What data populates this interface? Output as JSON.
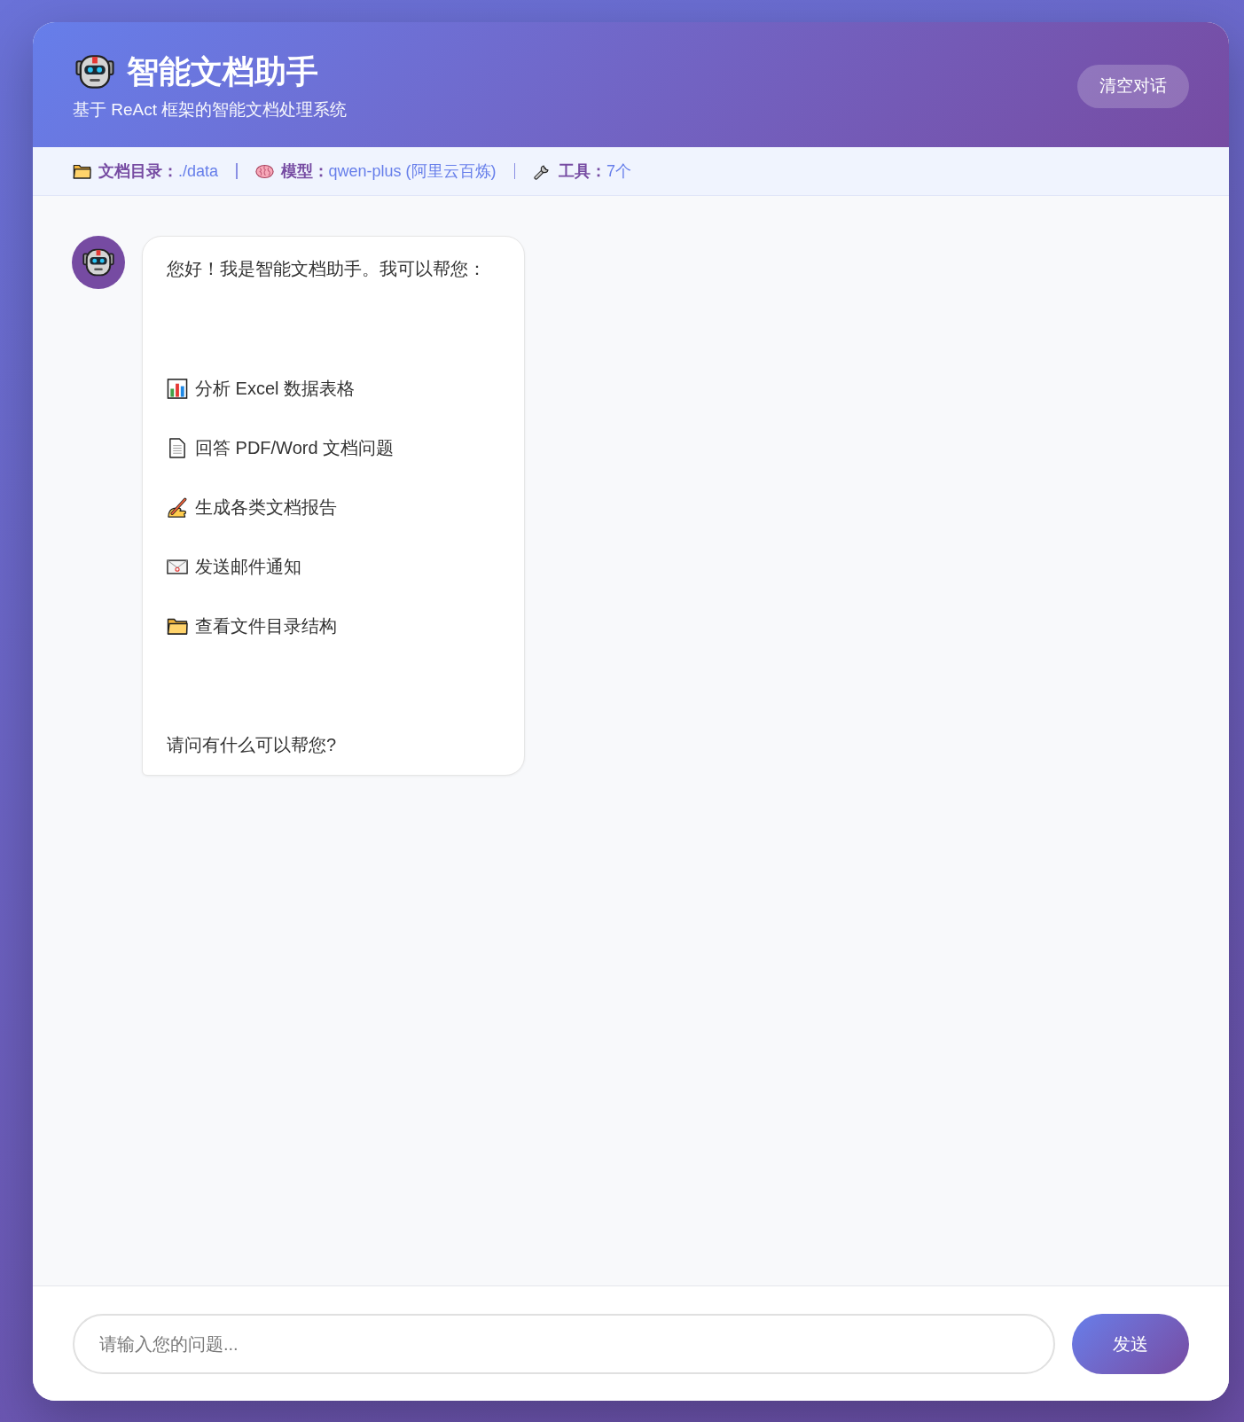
{
  "header": {
    "title": "智能文档助手",
    "subtitle": "基于 ReAct 框架的智能文档处理系统",
    "clear_button": "清空对话"
  },
  "info_bar": [
    {
      "kind": "folder",
      "label": "文档目录：",
      "value": "./data"
    },
    {
      "kind": "brain",
      "label": "模型：",
      "value": "qwen-plus (阿里云百炼)"
    },
    {
      "kind": "wrench",
      "label": "工具：",
      "value": "7个"
    }
  ],
  "messages": [
    {
      "kind": "assistant",
      "greeting": "您好！我是智能文档助手。我可以帮您：",
      "items": [
        {
          "kind": "chart",
          "text": "分析 Excel 数据表格"
        },
        {
          "kind": "document",
          "text": "回答 PDF/Word 文档问题"
        },
        {
          "kind": "writing",
          "text": "生成各类文档报告"
        },
        {
          "kind": "mail",
          "text": "发送邮件通知"
        },
        {
          "kind": "folder",
          "text": "查看文件目录结构"
        }
      ],
      "closing": "请问有什么可以帮您?"
    }
  ],
  "input": {
    "placeholder": "请输入您的问题...",
    "send_button": "发送"
  }
}
